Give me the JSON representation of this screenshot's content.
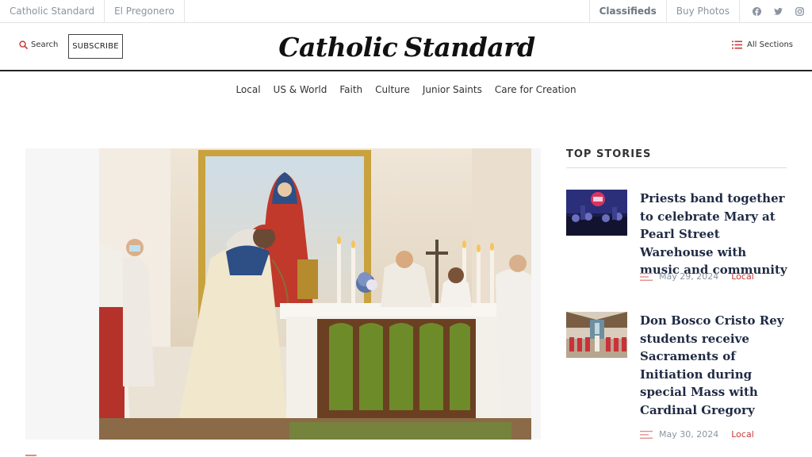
{
  "utility": {
    "sites": [
      "Catholic Standard",
      "El Pregonero"
    ],
    "classifieds": "Classifieds",
    "buy_photos": "Buy Photos",
    "social_icons": [
      "facebook-icon",
      "twitter-icon",
      "instagram-icon"
    ]
  },
  "masthead": {
    "search_label": "Search",
    "subscribe_label": "SUBSCRIBE",
    "logo_left": "Catholic",
    "logo_right": "Standard",
    "all_sections_label": "All Sections"
  },
  "nav": {
    "items": [
      "Local",
      "US & World",
      "Faith",
      "Culture",
      "Junior Saints",
      "Care for Creation"
    ]
  },
  "top_stories": {
    "heading": "TOP STORIES",
    "items": [
      {
        "title": "Priests band together to celebrate Mary at Pearl Street Warehouse with music and community",
        "date": "May 29, 2024",
        "category": "Local"
      },
      {
        "title": "Don Bosco Cristo Rey students receive Sacraments of Initiation during special Mass with Cardinal Gregory",
        "date": "May 30, 2024",
        "category": "Local"
      }
    ]
  },
  "colors": {
    "accent": "#c83a3a",
    "headline": "#1f2a44",
    "muted": "#8a94a0"
  }
}
